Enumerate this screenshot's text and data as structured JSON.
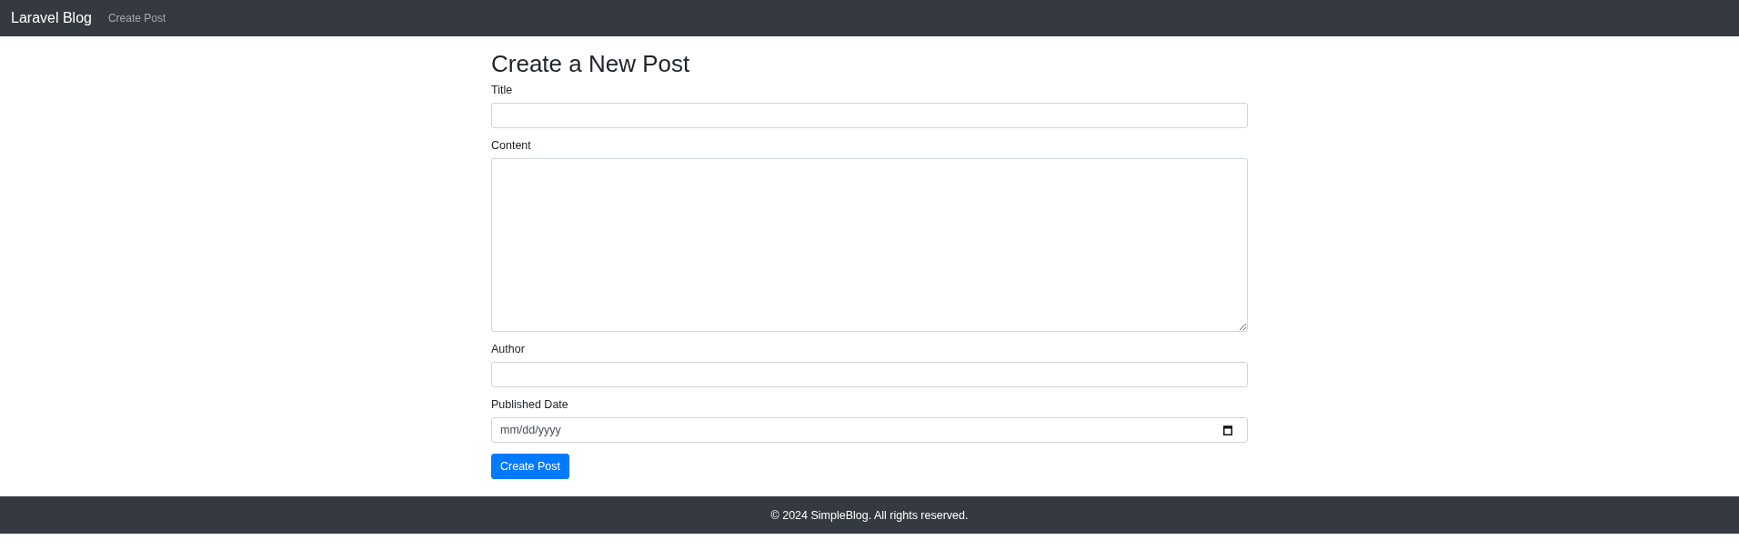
{
  "navbar": {
    "brand": "Laravel Blog",
    "links": [
      {
        "label": "Create Post"
      }
    ]
  },
  "form": {
    "heading": "Create a New Post",
    "fields": [
      {
        "kind": "text",
        "label": "Title"
      },
      {
        "kind": "textarea",
        "label": "Content"
      },
      {
        "kind": "text",
        "label": "Author"
      },
      {
        "kind": "date",
        "label": "Published Date",
        "placeholder": "mm/dd/yyyy"
      }
    ],
    "submit": "Create Post"
  },
  "footer": {
    "text": "© 2024 SimpleBlog. All rights reserved."
  }
}
